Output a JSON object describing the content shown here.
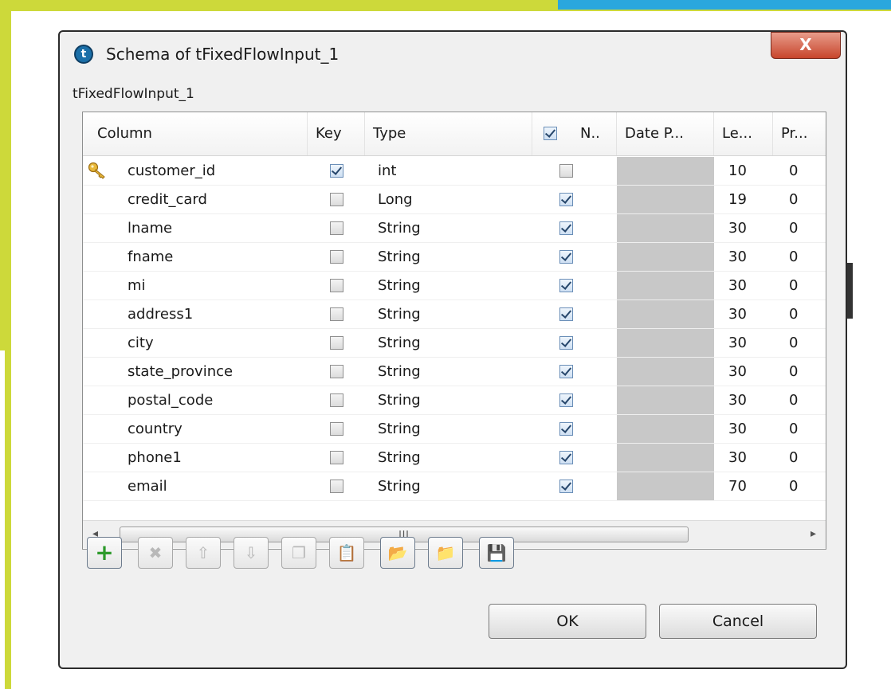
{
  "dialog": {
    "title": "Schema of tFixedFlowInput_1",
    "close_label": "X",
    "subtitle": "tFixedFlowInput_1"
  },
  "table": {
    "columns": [
      "Column",
      "Key",
      "Type",
      "N..",
      "Date P...",
      "Le...",
      "Pr..."
    ],
    "header_checkbox_checked": true,
    "rows": [
      {
        "name": "customer_id",
        "key": true,
        "type": "int",
        "nullable": false,
        "length": "10",
        "precision": "0",
        "key_icon": "key-icon"
      },
      {
        "name": "credit_card",
        "key": false,
        "type": "Long",
        "nullable": true,
        "length": "19",
        "precision": "0"
      },
      {
        "name": "lname",
        "key": false,
        "type": "String",
        "nullable": true,
        "length": "30",
        "precision": "0"
      },
      {
        "name": "fname",
        "key": false,
        "type": "String",
        "nullable": true,
        "length": "30",
        "precision": "0"
      },
      {
        "name": "mi",
        "key": false,
        "type": "String",
        "nullable": true,
        "length": "30",
        "precision": "0"
      },
      {
        "name": "address1",
        "key": false,
        "type": "String",
        "nullable": true,
        "length": "30",
        "precision": "0"
      },
      {
        "name": "city",
        "key": false,
        "type": "String",
        "nullable": true,
        "length": "30",
        "precision": "0"
      },
      {
        "name": "state_province",
        "key": false,
        "type": "String",
        "nullable": true,
        "length": "30",
        "precision": "0"
      },
      {
        "name": "postal_code",
        "key": false,
        "type": "String",
        "nullable": true,
        "length": "30",
        "precision": "0"
      },
      {
        "name": "country",
        "key": false,
        "type": "String",
        "nullable": true,
        "length": "30",
        "precision": "0"
      },
      {
        "name": "phone1",
        "key": false,
        "type": "String",
        "nullable": true,
        "length": "30",
        "precision": "0"
      },
      {
        "name": "email",
        "key": false,
        "type": "String",
        "nullable": true,
        "length": "70",
        "precision": "0"
      }
    ],
    "scroll_left_arrow": "◂",
    "scroll_right_arrow": "▸",
    "scroll_thumb_grip": "III"
  },
  "toolbar": {
    "buttons": [
      {
        "icon": "add-icon",
        "glyph": "+",
        "enabled": true
      },
      {
        "icon": "delete-icon",
        "glyph": "✖",
        "enabled": false
      },
      {
        "icon": "move-up-icon",
        "glyph": "⇧",
        "enabled": false
      },
      {
        "icon": "move-down-icon",
        "glyph": "⇩",
        "enabled": false
      },
      {
        "icon": "copy-icon",
        "glyph": "❐",
        "enabled": false
      },
      {
        "icon": "paste-icon",
        "glyph": "📋",
        "enabled": false
      },
      {
        "icon": "import-icon",
        "glyph": "📂",
        "enabled": true
      },
      {
        "icon": "export-icon",
        "glyph": "📁",
        "enabled": true
      },
      {
        "icon": "save-icon",
        "glyph": "💾",
        "enabled": true
      }
    ]
  },
  "footer": {
    "ok_label": "OK",
    "cancel_label": "Cancel"
  },
  "colors": {
    "frame_green": "#cdd93a",
    "frame_blue": "#2aa7de",
    "close_red": "#c8452c",
    "date_cell_gray": "#c8c8c8"
  }
}
